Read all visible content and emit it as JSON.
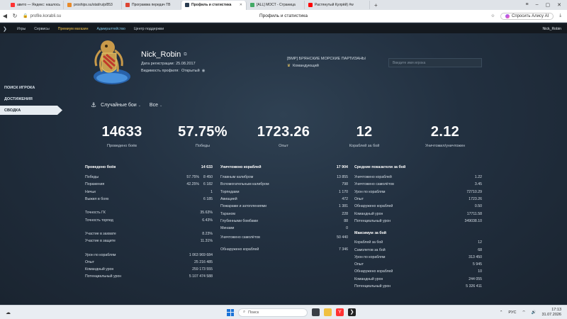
{
  "browser": {
    "tabs": [
      {
        "label": "авито — Яндекс: нашлось",
        "color": "#f33"
      },
      {
        "label": "proships.su/stat/ru/p/853",
        "color": "#e88a2a"
      },
      {
        "label": "Программа передач ТВ",
        "color": "#d43"
      },
      {
        "label": "Профиль и статистика",
        "color": "#2a3c50",
        "active": true
      },
      {
        "label": "[ALL] МОСТ - Страница",
        "color": "#4a6"
      },
      {
        "label": "Растянутый Кулрёй) #w",
        "color": "#f00"
      }
    ],
    "url": "profile.korabli.su",
    "page_title": "Профиль и статистика",
    "alice_label": "Спросить Алису AI"
  },
  "sitenav": {
    "items": [
      "Игры",
      "Сервисы",
      "Премиум магазин",
      "Адмиралтейство",
      "Центр поддержки"
    ],
    "user": "Nick_Robin"
  },
  "sidebar": {
    "items": [
      "ПОИСК ИГРОКА",
      "ДОСТИЖЕНИЯ",
      "СВОДКА"
    ]
  },
  "profile": {
    "nickname": "Nick_Robin",
    "reg_label": "Дата регистрации:",
    "reg_date": "25.08.2017",
    "visibility_label": "Видимость профиля:",
    "visibility_value": "Открытый",
    "clan": "[BMP] БРЯНСКИЕ МОРСКИЕ ПАРТИЗАНЫ",
    "role": "Командующий",
    "search_placeholder": "Введите имя игрока"
  },
  "filters": {
    "battle_type": "Случайные бои",
    "ship_filter": "Все"
  },
  "summary": [
    {
      "value": "14633",
      "label": "Проведено боёв"
    },
    {
      "value": "57.75%",
      "label": "Победы"
    },
    {
      "value": "1723.26",
      "label": "Опыт"
    },
    {
      "value": "12",
      "label": "Кораблей за бой"
    },
    {
      "value": "2.12",
      "label": "Уничтожил/уничтожен"
    }
  ],
  "battles": {
    "title": "Проведено боёв",
    "total": "14 633",
    "rows": [
      {
        "label": "Победы",
        "pct": "57.75%",
        "value": "8 450"
      },
      {
        "label": "Поражения",
        "pct": "42.25%",
        "value": "6 182"
      },
      {
        "label": "Ничьи",
        "pct": "",
        "value": "1"
      },
      {
        "label": "Выжил в боях",
        "pct": "",
        "value": "6 185"
      }
    ],
    "rows2": [
      {
        "label": "Точность ГК",
        "value": "35.63%"
      },
      {
        "label": "Точность торпед",
        "value": "6.43%"
      }
    ],
    "rows3": [
      {
        "label": "Участие в захвате",
        "value": "8.23%"
      },
      {
        "label": "Участие в защите",
        "value": "11.31%"
      }
    ],
    "rows4": [
      {
        "label": "Урон по кораблям",
        "value": "1 063 969 684"
      },
      {
        "label": "Опыт",
        "value": "25 216 485"
      },
      {
        "label": "Командный урон",
        "value": "259 173 555"
      },
      {
        "label": "Потенциальный урон",
        "value": "5 107 474 588"
      }
    ]
  },
  "destroyed": {
    "title": "Уничтожено кораблей",
    "total": "17 904",
    "rows": [
      {
        "label": "Главным калибром",
        "value": "13 855"
      },
      {
        "label": "Вспомогательным калибром",
        "value": "798"
      },
      {
        "label": "Торпедами",
        "value": "1 170"
      },
      {
        "label": "Авиацией",
        "value": "472"
      },
      {
        "label": "Пожарами и затоплениями",
        "value": "1 381"
      },
      {
        "label": "Тараном",
        "value": "228"
      },
      {
        "label": "Глубинными бомбами",
        "value": "88"
      },
      {
        "label": "Минами",
        "value": "0"
      }
    ],
    "rows2": [
      {
        "label": "Уничтожено самолётов",
        "value": "50 440"
      }
    ],
    "rows3": [
      {
        "label": "Обнаружено кораблей",
        "value": "7 346"
      }
    ]
  },
  "averages": {
    "title": "Средние показатели за бой",
    "rows": [
      {
        "label": "Уничтожено кораблей",
        "value": "1.22"
      },
      {
        "label": "Уничтожено самолётов",
        "value": "3.45"
      },
      {
        "label": "Урон по кораблям",
        "value": "72710.29"
      },
      {
        "label": "Опыт",
        "value": "1723.26"
      },
      {
        "label": "Обнаружено кораблей",
        "value": "0.50"
      },
      {
        "label": "Командный урон",
        "value": "17711.58"
      },
      {
        "label": "Потенциальный урон",
        "value": "349038.10"
      }
    ],
    "max_title": "Максимум за бой",
    "max_rows": [
      {
        "label": "Кораблей за бой",
        "value": "12"
      },
      {
        "label": "Самолетов за бой",
        "value": "68"
      },
      {
        "label": "Урон по кораблям",
        "value": "313 450"
      },
      {
        "label": "Опыт",
        "value": "5 945"
      },
      {
        "label": "Обнаружено кораблей",
        "value": "10"
      },
      {
        "label": "Командный урон",
        "value": "244 055"
      },
      {
        "label": "Потенциальный урон",
        "value": "5 326 411"
      }
    ]
  },
  "taskbar": {
    "search": "Поиск",
    "lang": "РУС",
    "time": "17:13",
    "date": "31.07.2026"
  }
}
